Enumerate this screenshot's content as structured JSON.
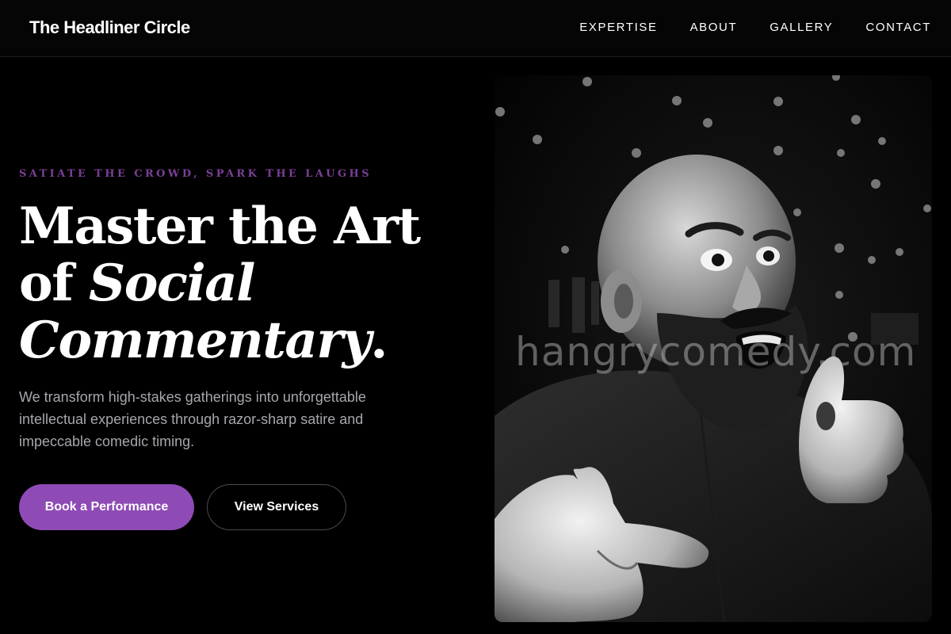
{
  "header": {
    "brand": "The Headliner Circle",
    "nav": [
      {
        "label": "EXPERTISE"
      },
      {
        "label": "ABOUT"
      },
      {
        "label": "GALLERY"
      },
      {
        "label": "CONTACT"
      }
    ]
  },
  "hero": {
    "eyebrow": "SATIATE THE CROWD, SPARK THE LAUGHS",
    "headline": {
      "line1": "Master the Art",
      "line2_plain": "of ",
      "line2_italic": "Social",
      "line3_italic": "Commentary",
      "line3_end": "."
    },
    "lede": "We transform high-stakes gatherings into unforgettable intellectual experiences through razor-sharp satire and impeccable comedic timing.",
    "primary_cta": "Book a Performance",
    "secondary_cta": "View Services",
    "image": {
      "watermark": "hangrycomedy.com",
      "icon": "comedian-photo"
    }
  },
  "colors": {
    "accent": "#8e4bb5",
    "eyebrow": "#7b3f97",
    "background": "#000000",
    "lede": "#a6a6ad"
  }
}
